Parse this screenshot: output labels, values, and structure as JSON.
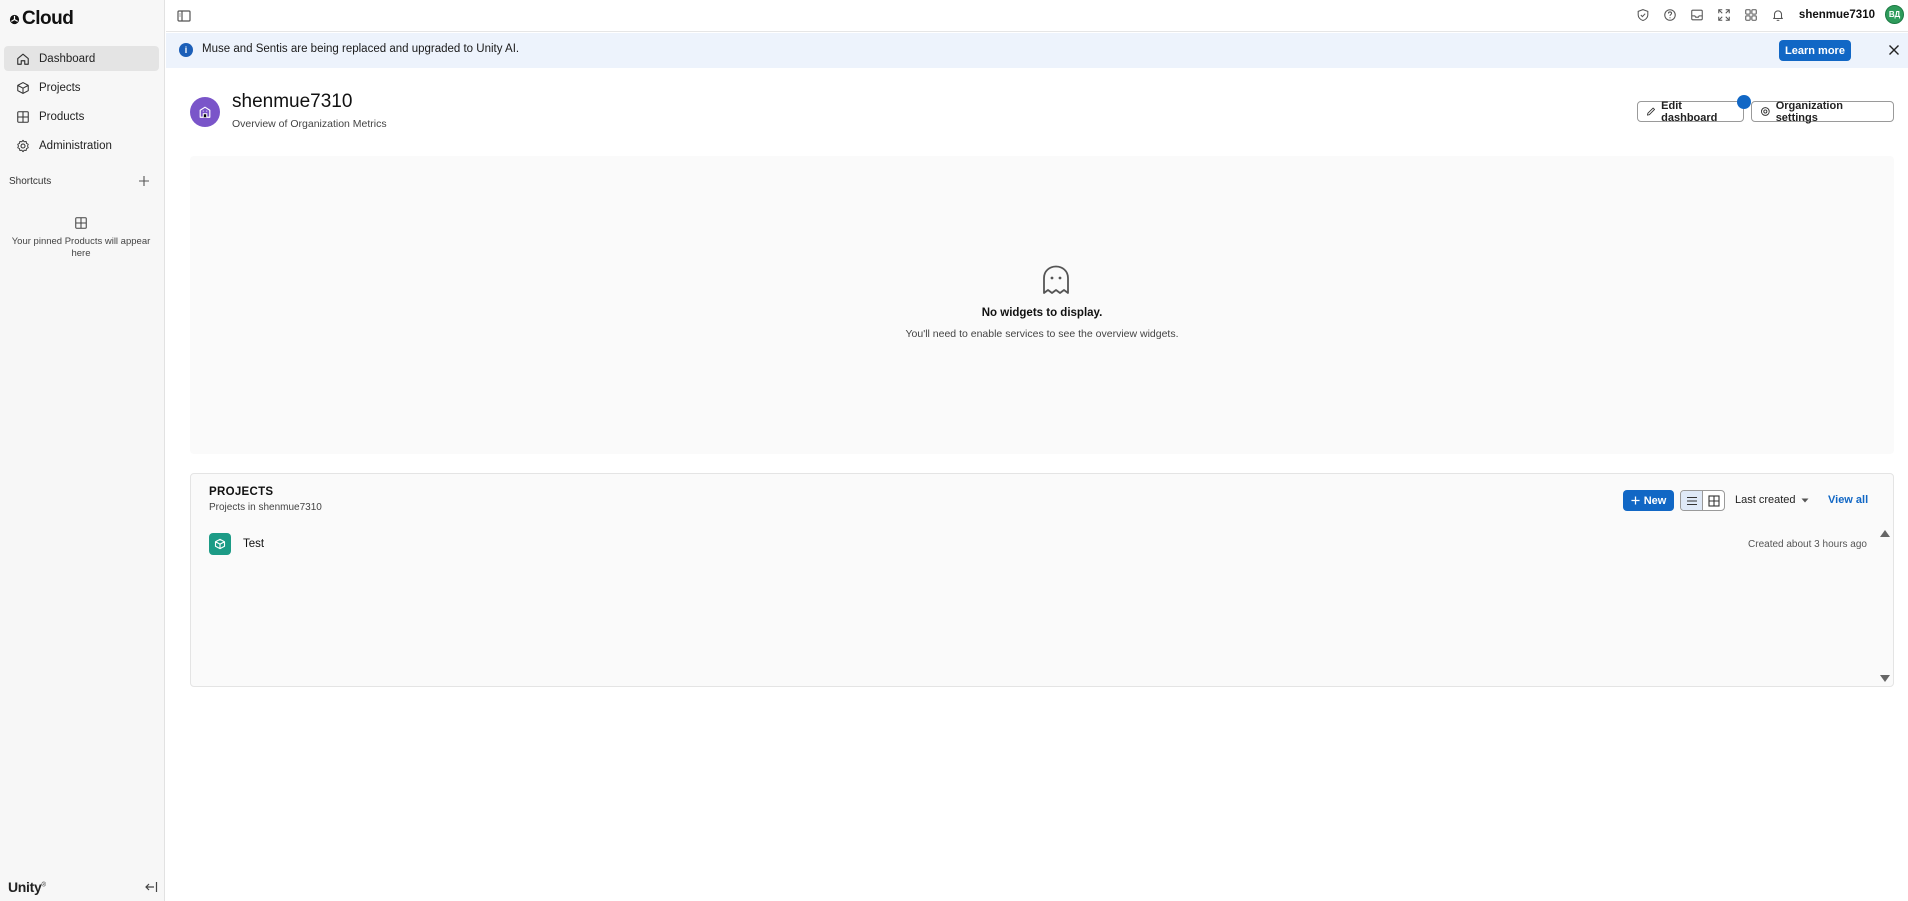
{
  "app": {
    "logo_text": "Cloud",
    "footer_brand": "Unity"
  },
  "sidebar": {
    "items": [
      {
        "label": "Dashboard",
        "icon": "home-icon"
      },
      {
        "label": "Projects",
        "icon": "cube-icon"
      },
      {
        "label": "Products",
        "icon": "grid-icon"
      },
      {
        "label": "Administration",
        "icon": "gear-icon"
      }
    ],
    "shortcuts_label": "Shortcuts",
    "pinned_empty": "Your pinned Products will appear here"
  },
  "topbar": {
    "username": "shenmue7310",
    "avatar_initials": "ВД",
    "icons": [
      "shield-icon",
      "help-icon",
      "inbox-icon",
      "fullscreen-icon",
      "apps-icon",
      "bell-icon"
    ]
  },
  "banner": {
    "text": "Muse and Sentis are being replaced and upgraded to Unity AI.",
    "button": "Learn more"
  },
  "header": {
    "title": "shenmue7310",
    "subtitle": "Overview of Organization Metrics",
    "edit_button": "Edit dashboard",
    "settings_button": "Organization settings"
  },
  "widgets": {
    "empty_title": "No widgets to display.",
    "empty_sub": "You'll need to enable services to see the overview widgets."
  },
  "projects": {
    "title": "PROJECTS",
    "subtitle": "Projects in shenmue7310",
    "new_button": "New",
    "sort_label": "Last created",
    "view_all": "View all",
    "rows": [
      {
        "name": "Test",
        "created": "Created about 3 hours ago"
      }
    ]
  },
  "colors": {
    "accent": "#1167c5",
    "banner_bg": "#edf3fc",
    "org_avatar": "#7a55c9",
    "project_icon": "#1c9b86"
  }
}
